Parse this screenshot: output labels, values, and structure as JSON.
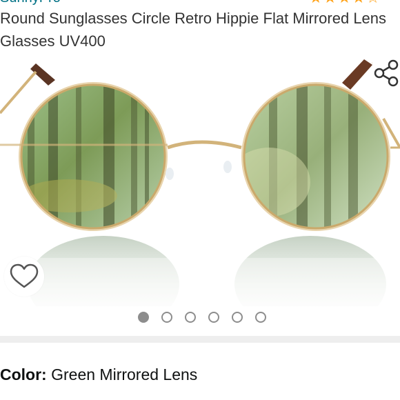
{
  "product": {
    "brand": "SunnyPro",
    "rating_stars": "★★★★☆",
    "title": "Round Sunglasses Circle Retro Hippie Flat Mirrored Lens Glasses UV400"
  },
  "gallery": {
    "image_count": 6,
    "active_index": 0
  },
  "variation": {
    "label": "Color:",
    "value": "Green Mirrored Lens"
  },
  "icons": {
    "share": "share-icon",
    "wishlist": "heart-outline-icon"
  },
  "colors": {
    "link": "#007185",
    "star": "#ffa41c",
    "dot": "#8d8d8d",
    "frame": "#d2b37a",
    "lens": "#9bbf86"
  }
}
